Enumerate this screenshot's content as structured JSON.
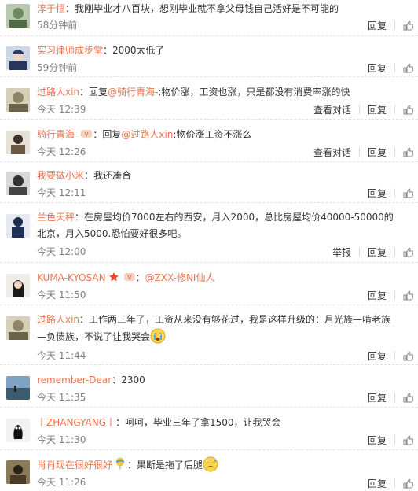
{
  "comments": [
    {
      "author": "淳于恒",
      "text": "：我刚毕业才八百块，想刚毕业就不拿父母钱自己活好是不可能的",
      "time": "58分钟前",
      "reply": "回复"
    },
    {
      "author": "实习律师成步堂",
      "text": "：2000太低了",
      "time": "59分钟前",
      "reply": "回复"
    },
    {
      "author": "过路人xin",
      "pre": "：回复",
      "mention": "@骑行青海-",
      "text": ":物价涨，工资也涨，只是都没有消费率涨的快",
      "time": "今天 12:39",
      "view": "查看对话",
      "reply": "回复"
    },
    {
      "author": "骑行青海-",
      "pre": "：回复",
      "mention": "@过路人xin",
      "text": ":物价涨工资不涨么",
      "time": "今天 12:26",
      "view": "查看对话",
      "reply": "回复"
    },
    {
      "author": "我要做小米",
      "text": "：我还凑合",
      "time": "今天 12:11",
      "reply": "回复"
    },
    {
      "author": "兰色天秤",
      "text": "：在房屋均价7000左右的西安，月入2000，总比房屋均价40000-50000的北京，月入5000.恐怕要好很多吧。",
      "time": "今天 12:00",
      "report": "举报",
      "reply": "回复"
    },
    {
      "author": "KUMA-KYOSAN",
      "mention": "@ZXX-修NI仙人",
      "time": "今天 11:50",
      "reply": "回复"
    },
    {
      "author": "过路人xin",
      "text": "：工作两三年了，工资从来没有够花过，我是这样升级的：月光族—啃老族—负债族，不说了让我哭会",
      "time": "今天 11:44",
      "reply": "回复"
    },
    {
      "author": "remember-Dear",
      "text": "：2300",
      "time": "今天 11:35",
      "reply": "回复"
    },
    {
      "author": "丨ZHANGYANG丨",
      "text": "：呵呵，毕业三年了拿1500，让我哭会",
      "time": "今天 11:30",
      "reply": "回复"
    },
    {
      "author": "肖肖现在很好很好",
      "text": "：果断是拖了后腿",
      "time": "今天 11:26",
      "reply": "回复"
    }
  ],
  "colors": {
    "author": "#eb7350",
    "time": "#808080",
    "text": "#333333"
  }
}
